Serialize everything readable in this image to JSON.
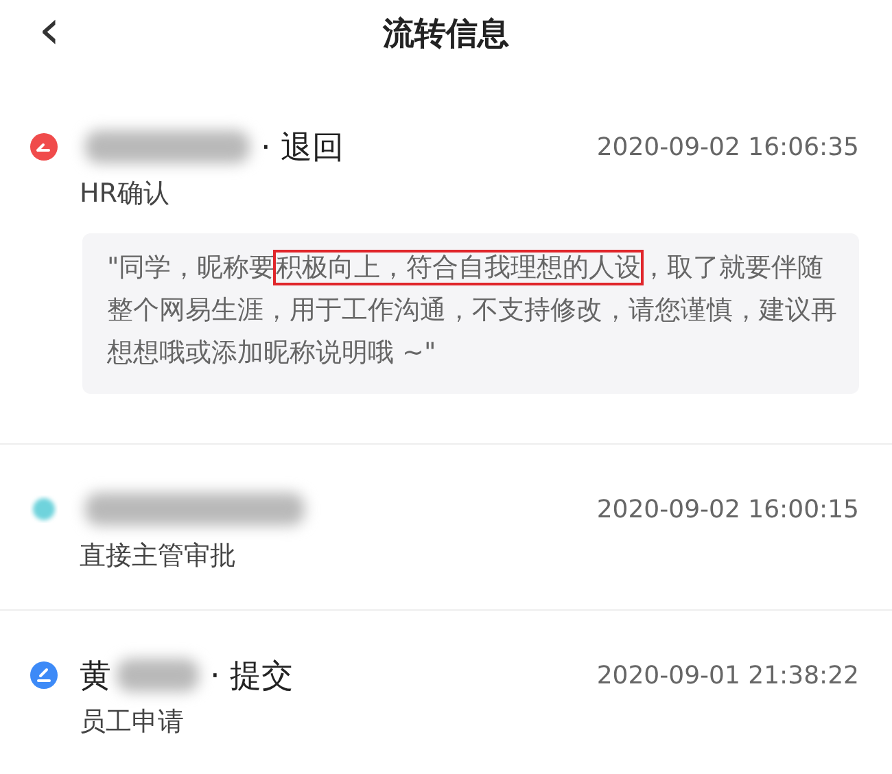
{
  "header": {
    "back_icon": "‹",
    "title": "流转信息"
  },
  "records": [
    {
      "kind": "return",
      "color": "#f04b4b",
      "action": "· 退回",
      "time": "2020-09-02 16:06:35",
      "step": "HR确认",
      "comment": [
        {
          "text": "\"同学，昵称要",
          "highlighted": false
        },
        {
          "text": "积极向上，符合自我理想的人设",
          "highlighted": true
        },
        {
          "text": "，取了就要伴随整个网易生涯，用于工作沟通，不支持修改，请您谨慎，建议再想想哦或添加昵称说明哦 ~\"",
          "highlighted": false
        }
      ]
    },
    {
      "kind": "blurred",
      "color": "#6fd3dc",
      "time": "2020-09-02 16:00:15",
      "step": "直接主管审批"
    },
    {
      "kind": "submit",
      "color": "#3d8af7",
      "name_visible": "黄",
      "action": "· 提交",
      "time": "2020-09-01 21:38:22",
      "step": "员工申请"
    }
  ]
}
